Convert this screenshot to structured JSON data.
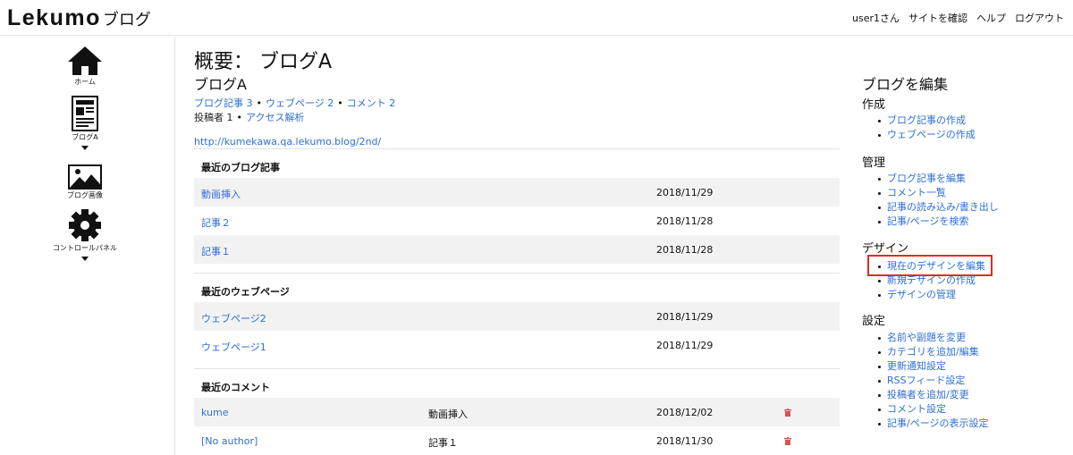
{
  "header": {
    "logo_main": "Lekumo",
    "logo_sub": "ブログ",
    "nav": [
      "user1さん",
      "サイトを確認",
      "ヘルプ",
      "ログアウト"
    ]
  },
  "sidebar": {
    "items": [
      {
        "label": "ホーム",
        "icon": "home-icon"
      },
      {
        "label": "ブログA",
        "icon": "blog-page-icon"
      },
      {
        "label": "ブログ画像",
        "icon": "image-icon"
      },
      {
        "label": "コントロールパネル",
        "icon": "gear-icon"
      }
    ]
  },
  "main": {
    "title": "概要： ブログA",
    "blog_name": "ブログA",
    "stats": {
      "entries": "ブログ記事 3",
      "pages": "ウェブページ 2",
      "comments": "コメント 2",
      "authors": "投稿者 1",
      "analytics": "アクセス解析",
      "separator": "•"
    },
    "blog_url": "http://kumekawa.qa.lekumo.blog/2nd/",
    "recent_entries": {
      "heading": "最近のブログ記事",
      "rows": [
        {
          "title": "動画挿入",
          "date": "2018/11/29"
        },
        {
          "title": "記事２",
          "date": "2018/11/28"
        },
        {
          "title": "記事１",
          "date": "2018/11/28"
        }
      ]
    },
    "recent_pages": {
      "heading": "最近のウェブページ",
      "rows": [
        {
          "title": "ウェブページ2",
          "date": "2018/11/29"
        },
        {
          "title": "ウェブページ1",
          "date": "2018/11/29"
        }
      ]
    },
    "recent_comments": {
      "heading": "最近のコメント",
      "rows": [
        {
          "author": "kume",
          "entry": "動画挿入",
          "date": "2018/12/02"
        },
        {
          "author": "[No author]",
          "entry": "記事１",
          "date": "2018/11/30"
        }
      ]
    }
  },
  "right": {
    "title": "ブログを編集",
    "groups": [
      {
        "heading": "作成",
        "items": [
          "ブログ記事の作成",
          "ウェブページの作成"
        ]
      },
      {
        "heading": "管理",
        "items": [
          "ブログ記事を編集",
          "コメント一覧",
          "記事の読み込み/書き出し",
          "記事/ページを検索"
        ]
      },
      {
        "heading": "デザイン",
        "items": [
          "現在のデザインを編集",
          "新規デザインの作成",
          "デザインの管理"
        ]
      },
      {
        "heading": "設定",
        "items": [
          "名前や副題を変更",
          "カテゴリを追加/編集",
          "更新通知設定",
          "RSSフィード設定",
          "投稿者を追加/変更",
          "コメント設定",
          "記事/ページの表示設定"
        ]
      }
    ],
    "highlighted_item": "現在のデザインを編集"
  },
  "colors": {
    "link": "#2f6fd6",
    "highlight": "#e02b20",
    "row_shade": "#f2f2f2",
    "trash": "#d9534f"
  }
}
